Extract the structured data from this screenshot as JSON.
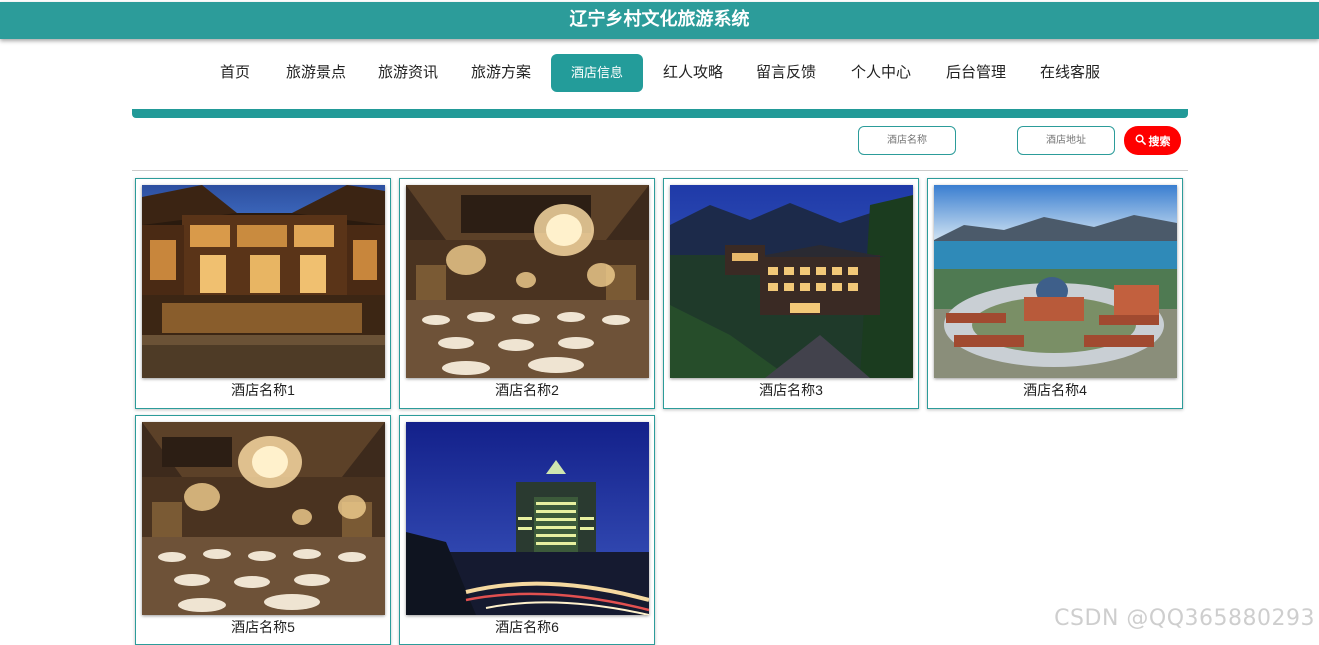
{
  "header": {
    "title": "辽宁乡村文化旅游系统"
  },
  "nav": {
    "items": [
      {
        "label": "首页"
      },
      {
        "label": "旅游景点"
      },
      {
        "label": "旅游资讯"
      },
      {
        "label": "旅游方案"
      },
      {
        "label": "酒店信息",
        "active": true
      },
      {
        "label": "红人攻略"
      },
      {
        "label": "留言反馈"
      },
      {
        "label": "个人中心"
      },
      {
        "label": "后台管理"
      },
      {
        "label": "在线客服"
      }
    ]
  },
  "search": {
    "name_placeholder": "酒店名称",
    "address_placeholder": "酒店地址",
    "button_label": "搜索",
    "button_icon": "search-icon"
  },
  "hotels": [
    {
      "name": "酒店名称1",
      "image": "courtyard-inn-photo"
    },
    {
      "name": "酒店名称2",
      "image": "banquet-hall-photo"
    },
    {
      "name": "酒店名称3",
      "image": "mountain-resort-photo"
    },
    {
      "name": "酒店名称4",
      "image": "seaside-complex-photo"
    },
    {
      "name": "酒店名称5",
      "image": "banquet-hall-photo"
    },
    {
      "name": "酒店名称6",
      "image": "city-tower-night-photo"
    }
  ],
  "watermark": "CSDN @QQ365880293",
  "colors": {
    "accent": "#2c9c9a",
    "search_button": "#ff0000"
  }
}
